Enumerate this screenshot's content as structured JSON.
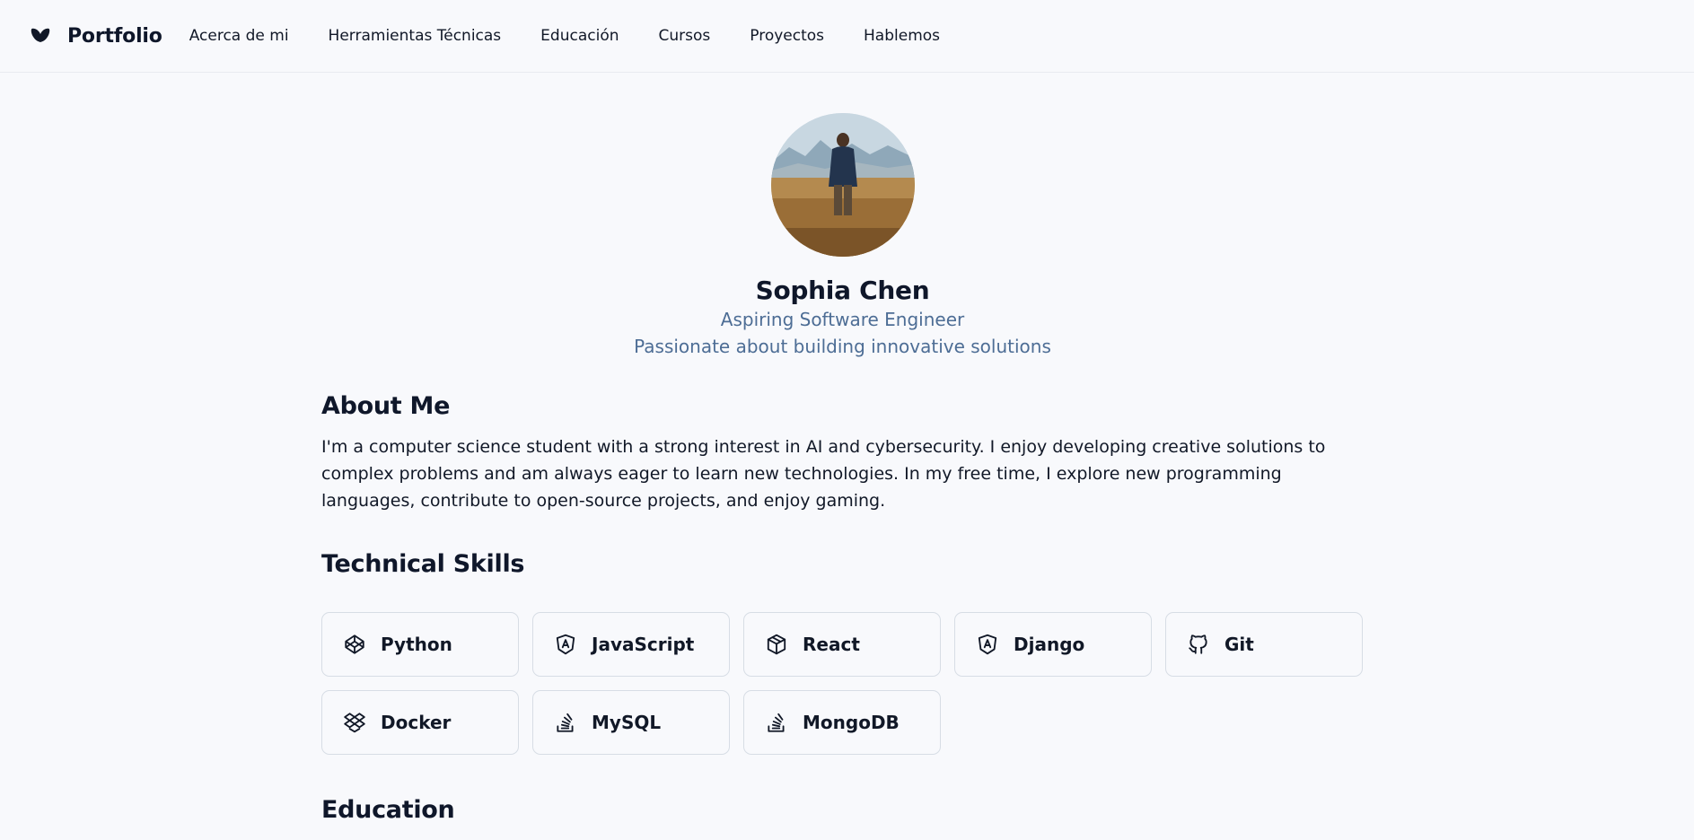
{
  "header": {
    "logo_icon": "butterfly-logo-icon",
    "brand": "Portfolio",
    "nav": [
      {
        "label": "Acerca de mi"
      },
      {
        "label": "Herramientas Técnicas"
      },
      {
        "label": "Educación"
      },
      {
        "label": "Cursos"
      },
      {
        "label": "Proyectos"
      },
      {
        "label": "Hablemos"
      }
    ]
  },
  "profile": {
    "avatar_alt": "person standing in a field",
    "name": "Sophia Chen",
    "title": "Aspiring Software Engineer",
    "tagline": "Passionate about building innovative solutions"
  },
  "about": {
    "heading": "About Me",
    "text": "I'm a computer science student with a strong interest in AI and cybersecurity. I enjoy developing creative solutions to complex problems and am always eager to learn new technologies. In my free time, I explore new programming languages, contribute to open-source projects, and enjoy gaming."
  },
  "skills": {
    "heading": "Technical Skills",
    "items": [
      {
        "label": "Python",
        "icon": "codepen-icon"
      },
      {
        "label": "JavaScript",
        "icon": "angular-icon"
      },
      {
        "label": "React",
        "icon": "box-icon"
      },
      {
        "label": "Django",
        "icon": "angular-icon"
      },
      {
        "label": "Git",
        "icon": "github-icon"
      },
      {
        "label": "Docker",
        "icon": "dropbox-icon"
      },
      {
        "label": "MySQL",
        "icon": "stack-overflow-icon"
      },
      {
        "label": "MongoDB",
        "icon": "stack-overflow-icon"
      }
    ]
  },
  "education": {
    "heading": "Education"
  },
  "colors": {
    "background": "#f8f9fc",
    "accent_text": "#4d6d95",
    "card_border": "#d7dde5"
  }
}
